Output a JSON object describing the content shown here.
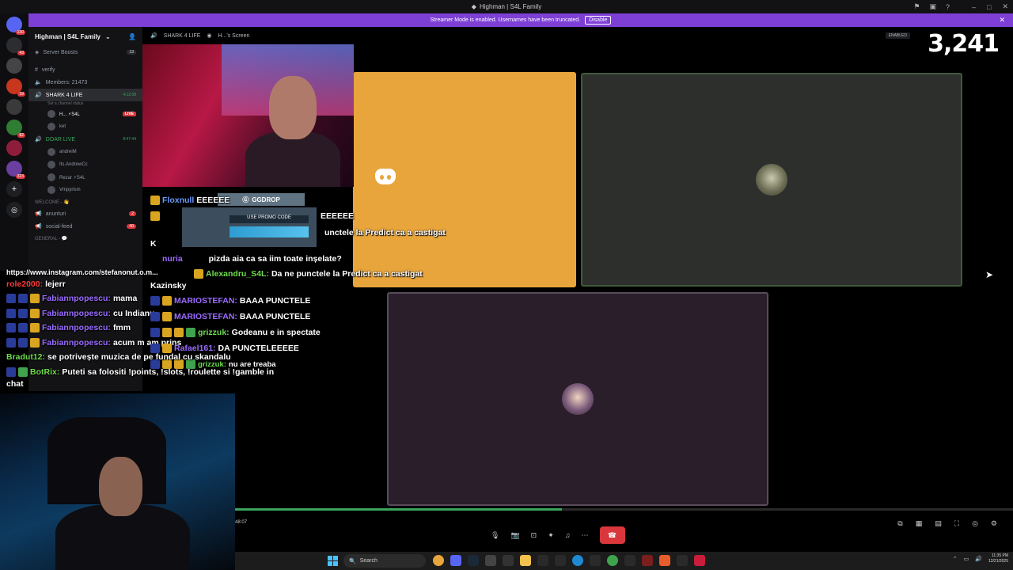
{
  "titlebar": {
    "title": "Highman | S4L Family"
  },
  "banner": {
    "text": "Streamer Mode is enabled. Usernames have been truncated.",
    "disable_label": "Disable"
  },
  "rail": {
    "badges": [
      "130",
      "43",
      "19",
      "82",
      "323"
    ]
  },
  "sidebar": {
    "server_name": "Highman | S4L Family",
    "boosts": {
      "label": "Server Boosts",
      "count": "13"
    },
    "channels": [
      {
        "label": "verify"
      },
      {
        "label": "Members: 21473"
      }
    ],
    "voice1": {
      "label": "SHARK 4 LIFE",
      "time": "4:12:08",
      "status": "Set a channel status"
    },
    "voice1_users": [
      {
        "name": "H... ⚡S4L",
        "live": "LIVE"
      },
      {
        "name": "ket"
      }
    ],
    "voice2": {
      "label": "DOAR LIVE",
      "time": "8:47:44"
    },
    "voice2_users": [
      {
        "name": "andreiM"
      },
      {
        "name": "Its.AndrewCc"
      },
      {
        "name": "Rezar ⚡S4L"
      },
      {
        "name": "Vmpyrism"
      }
    ],
    "cat_welcome": "WELCOME - 👋",
    "text_channels": [
      {
        "label": "anunturi",
        "badge": "2"
      },
      {
        "label": "social-feed",
        "badge": "40"
      }
    ],
    "cat_general": "GENERAL - 💬"
  },
  "callhdr": {
    "channel": "SHARK 4 LIFE",
    "screen": "H...'s Screen",
    "enabled": "ENABLED"
  },
  "viewers": "3,241",
  "ggdrop": {
    "label": "GGDROP",
    "code_label": "USE PROMO CODE"
  },
  "chat": {
    "top": [
      {
        "name": "Floxnull",
        "text": "EEEEEE"
      },
      {
        "name": "",
        "text": "EEEEEE"
      },
      {
        "name": "",
        "text": "unctele la Predict ca a castigat"
      },
      {
        "name": "nuria",
        "text": "pizda aia ca sa iim toate inșelate?"
      },
      {
        "name": "Alexandru_S4L:",
        "text": "Da ne punctele la Predict ca a castigat"
      }
    ],
    "kazinsky": "Kazinsky",
    "k": "K",
    "link": "https://www.instagram.com/stefanonut.o.m...",
    "role": "role2000:",
    "role_text": "lejerr",
    "fab": [
      {
        "name": "Fabiannpopescu:",
        "text": "mama"
      },
      {
        "name": "Fabiannpopescu:",
        "text": "cu Indianu"
      },
      {
        "name": "Fabiannpopescu:",
        "text": "fmm"
      },
      {
        "name": "Fabiannpopescu:",
        "text": "acum m am prins"
      }
    ],
    "right": [
      {
        "name": "MARIOSTEFAN:",
        "text": "BAAA PUNCTELE"
      },
      {
        "name": "MARIOSTEFAN:",
        "text": "BAAA PUNCTELE"
      },
      {
        "name": "grizzuk:",
        "text": "Godeanu e in spectate"
      },
      {
        "name": "Rafael161:",
        "text": "DA PUNCTELEEEEE"
      },
      {
        "name": "grizzuk:",
        "text": "nu are treaba"
      }
    ],
    "bradut": {
      "name": "Bradut12:",
      "text": "se potrivește muzica de pe fundal cu skandalu"
    },
    "botrix": {
      "name": "BotRix:",
      "text": "Puteti sa folositi !points, !slots, !roulette si !gamble in",
      "text2": "chat"
    }
  },
  "player": {
    "time": "48:07"
  },
  "taskbar": {
    "search": "Search",
    "time": "11:35 PM",
    "date": "12/21/2025"
  }
}
